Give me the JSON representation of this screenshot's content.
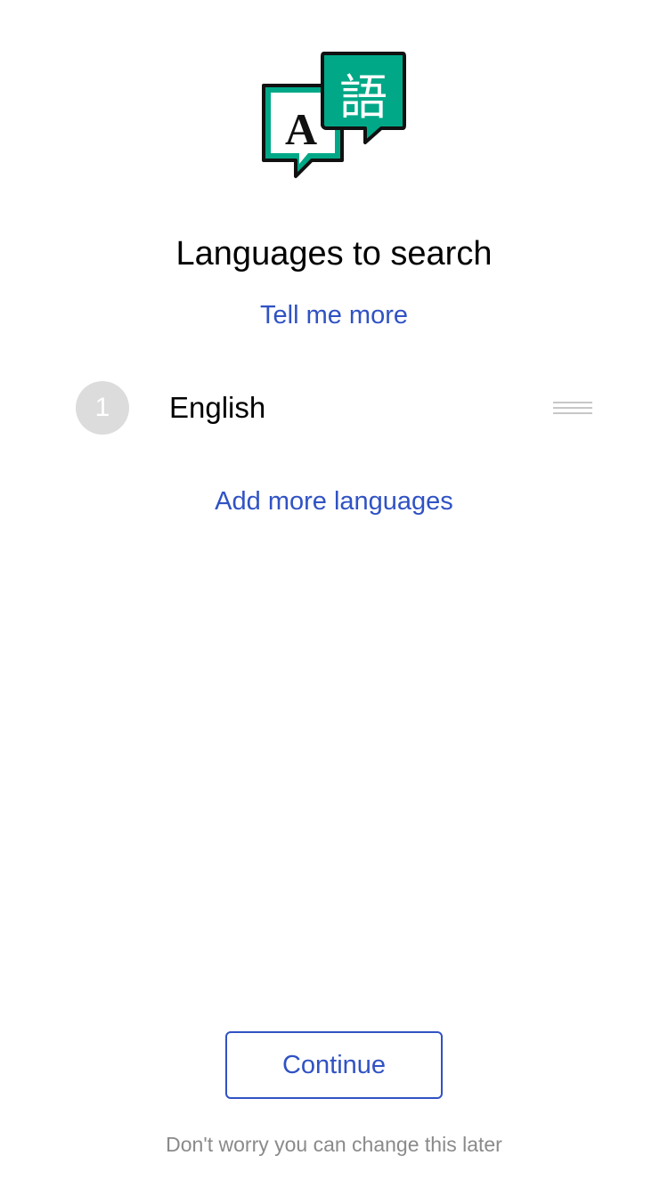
{
  "logo": {
    "latin_glyph": "A",
    "cjk_glyph": "語",
    "accent_color": "#00a887"
  },
  "header": {
    "title": "Languages to search",
    "tell_more_link": "Tell me more"
  },
  "languages": [
    {
      "rank": "1",
      "name": "English"
    }
  ],
  "actions": {
    "add_more_link": "Add more languages",
    "continue_label": "Continue"
  },
  "footer": {
    "note": "Don't worry you can change this later"
  },
  "colors": {
    "link": "#3052c4",
    "badge": "#dcdcdc",
    "muted_text": "#8a8a8a"
  }
}
